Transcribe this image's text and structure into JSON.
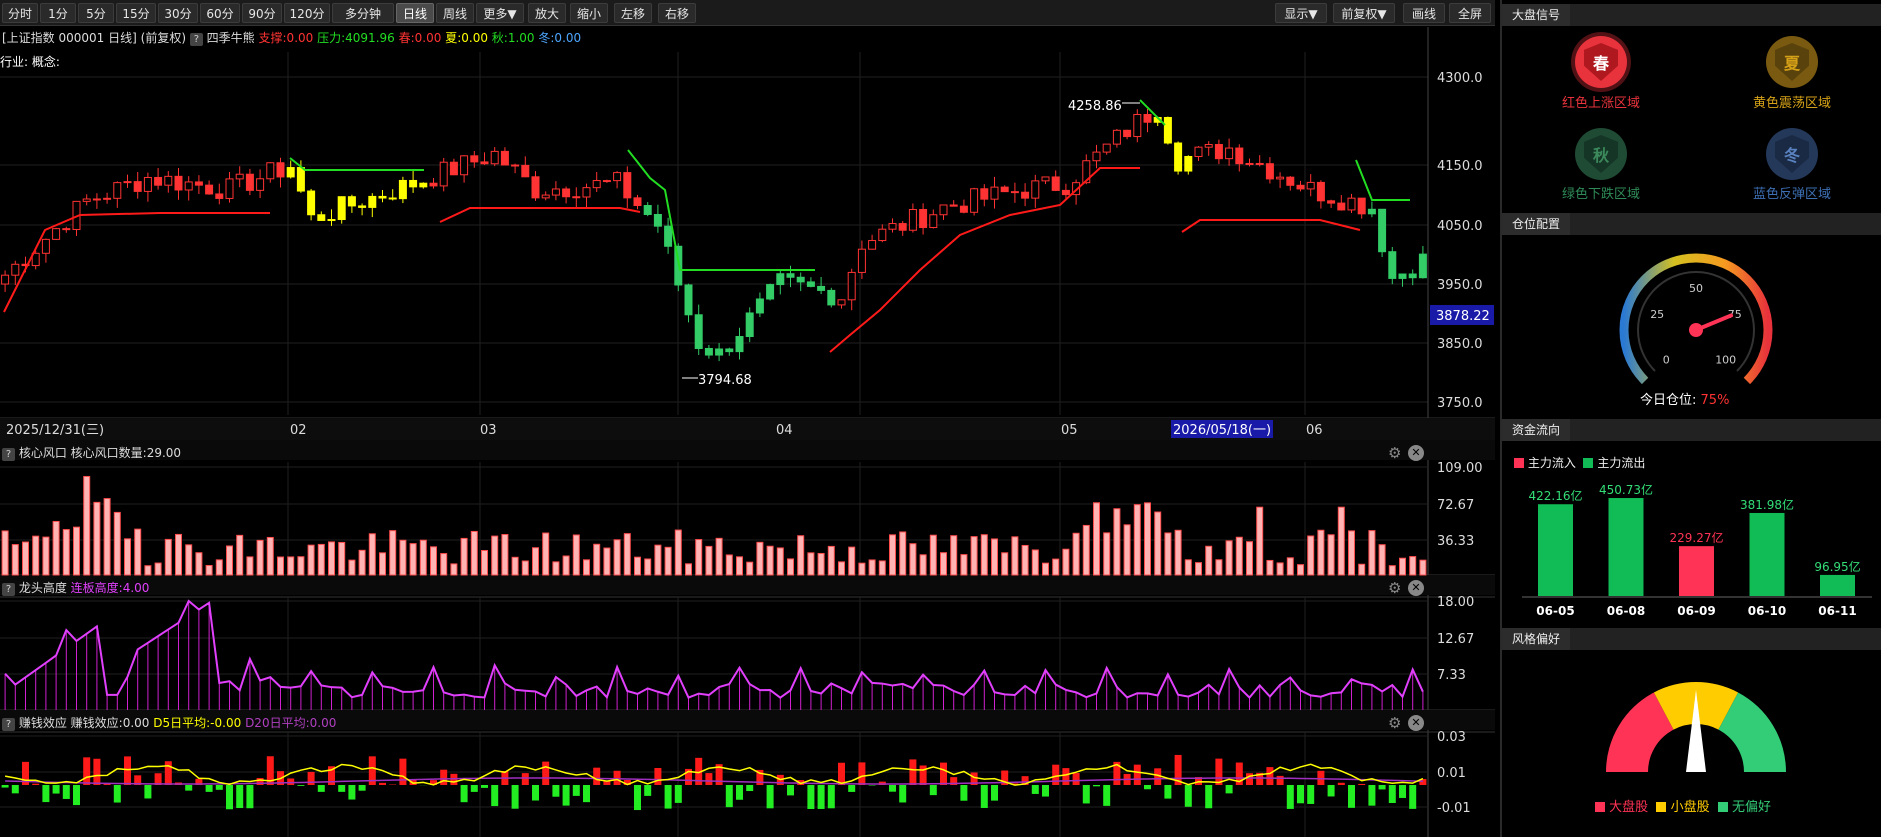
{
  "toolbar": {
    "periods": [
      "分时",
      "1分",
      "5分",
      "15分",
      "30分",
      "60分",
      "90分",
      "120分",
      "多分钟",
      "日线",
      "周线",
      "更多▼"
    ],
    "active_period": "日线",
    "actions": [
      "放大",
      "缩小",
      "左移",
      "右移"
    ],
    "right": [
      "显示▼",
      "前复权▼",
      "画线",
      "全屏"
    ]
  },
  "info": {
    "stock": "[上证指数 000001 日线]",
    "adjust": "(前复权)",
    "help": "?",
    "indicator": "四季牛熊",
    "support": "支撑:0.00",
    "pressure": "压力:4091.96",
    "spring": "春:0.00",
    "summer": "夏:0.00",
    "autumn": "秋:1.00",
    "winter": "冬:0.00",
    "industry": "行业:",
    "concept": "概念:"
  },
  "main_chart": {
    "y_ticks": [
      "4300.0",
      "4150.0",
      "4050.0",
      "3950.0",
      "3850.0",
      "3750.0"
    ],
    "current_price": "3878.22",
    "high_label": "4258.86",
    "low_label": "3794.68",
    "date_labels": [
      "2025/12/31(三)",
      "02",
      "03",
      "04",
      "05",
      "06"
    ],
    "highlighted_date": "2026/05/18(一)",
    "colors": {
      "up": "#ff3333",
      "down": "#33cc66",
      "neutral": "#ffff00",
      "support_line": "#ff1a1a",
      "pressure_line": "#22dd22"
    }
  },
  "panels": [
    {
      "help": "?",
      "name": "核心风口",
      "value_label": "核心风口数量:29.00",
      "ticks": [
        "109.00",
        "72.67",
        "36.33"
      ]
    },
    {
      "help": "?",
      "name": "龙头高度",
      "value_label": "连板高度:4.00",
      "ticks": [
        "18.00",
        "12.67",
        "7.33"
      ]
    },
    {
      "help": "?",
      "name": "赚钱效应",
      "value_label": "赚钱效应:0.00",
      "d5": "D5日平均:-0.00",
      "d20": "D20日平均:0.00",
      "ticks": [
        "0.03",
        "0.01",
        "-0.01"
      ]
    }
  ],
  "side": {
    "signal_title": "大盘信号",
    "signals": [
      {
        "char": "春",
        "label": "红色上涨区域",
        "color": "#e8323c",
        "active": true
      },
      {
        "char": "夏",
        "label": "黄色震荡区域",
        "color": "#d4a017",
        "active": false
      },
      {
        "char": "秋",
        "label": "绿色下跌区域",
        "color": "#2e8b57",
        "active": false
      },
      {
        "char": "冬",
        "label": "蓝色反弹区域",
        "color": "#3d6fb4",
        "active": false
      }
    ],
    "position_title": "仓位配置",
    "gauge_ticks": [
      "0",
      "25",
      "50",
      "75",
      "100"
    ],
    "position_label": "今日仓位:",
    "position_value": "75%",
    "position_fraction": 0.75,
    "fund_title": "资金流向",
    "legend_in": "主力流入",
    "legend_out": "主力流出",
    "style_title": "风格偏好",
    "style_legend": [
      {
        "label": "大盘股",
        "color": "#ff3355"
      },
      {
        "label": "小盘股",
        "color": "#ffcc00"
      },
      {
        "label": "无偏好",
        "color": "#33cc77"
      }
    ]
  },
  "chart_data": {
    "type": "bar",
    "categories": [
      "06-05",
      "06-08",
      "06-09",
      "06-10",
      "06-11"
    ],
    "values": [
      422.16,
      450.73,
      229.27,
      381.98,
      96.95
    ],
    "value_labels": [
      "422.16亿",
      "450.73亿",
      "229.27亿",
      "381.98亿",
      "96.95亿"
    ],
    "directions": [
      "out",
      "out",
      "in",
      "out",
      "out"
    ]
  }
}
